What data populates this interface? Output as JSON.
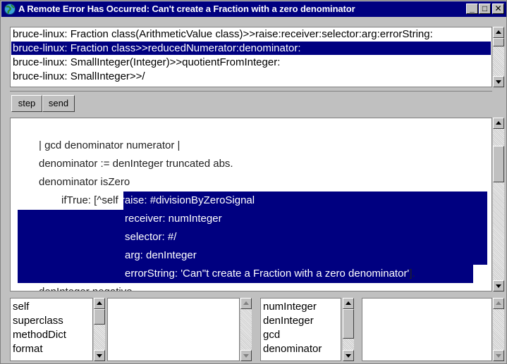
{
  "window": {
    "title": "A Remote Error Has Occurred: Can't create a Fraction with a zero denominator",
    "controls": {
      "minimize": "_",
      "maximize": "□",
      "close": "✕"
    }
  },
  "stack": {
    "items": [
      "bruce-linux: Fraction class(ArithmeticValue class)>>raise:receiver:selector:arg:errorString:",
      "bruce-linux: Fraction class>>reducedNumerator:denominator:",
      "bruce-linux: SmallInteger(Integer)>>quotientFromInteger:",
      "bruce-linux: SmallInteger>>/"
    ],
    "selected_index": 1
  },
  "toolbar": {
    "step_label": "step",
    "send_label": "send"
  },
  "code": {
    "line1": "| gcd denominator numerator |",
    "line2": "denominator := denInteger truncated abs.",
    "line3": "denominator isZero",
    "line4_prefix": "ifTrue: [^self ",
    "line4_hl": "raise: #divisionByZeroSignal",
    "line5": "receiver: numInteger",
    "line6": "selector: #/",
    "line7": "arg: denInteger",
    "line8_hl": "errorString: 'Can''t create a Fraction with a zero denominator'",
    "line8_suffix": "].",
    "line9": "denInteger negative"
  },
  "receiver_inspector": {
    "fields": [
      "self",
      "superclass",
      "methodDict",
      "format"
    ]
  },
  "context_inspector": {
    "fields": [
      "numInteger",
      "denInteger",
      "gcd",
      "denominator"
    ]
  },
  "colors": {
    "selection": "#000080",
    "chrome": "#c0c0c0"
  }
}
